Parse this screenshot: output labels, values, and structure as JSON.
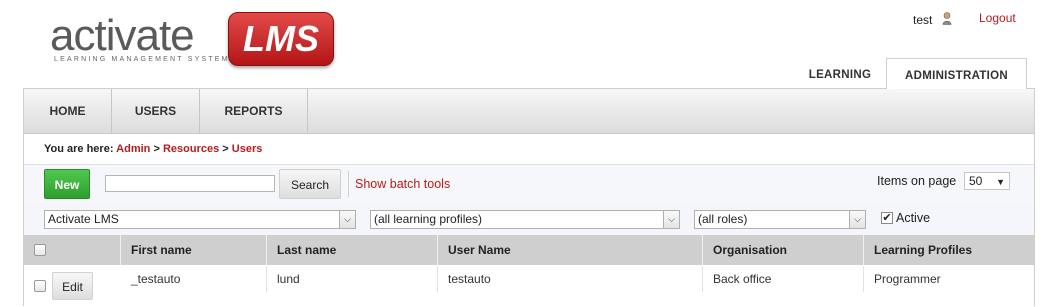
{
  "logo": {
    "word": "activate",
    "badge": "LMS",
    "tagline": "LEARNING MANAGEMENT SYSTEM"
  },
  "header": {
    "username": "test",
    "logout_label": "Logout"
  },
  "top_tabs": [
    {
      "label": "LEARNING"
    },
    {
      "label": "ADMINISTRATION"
    }
  ],
  "nav": {
    "home": "HOME",
    "users": "USERS",
    "reports": "REPORTS"
  },
  "breadcrumb": {
    "prefix": "You are here:",
    "items": [
      "Admin",
      "Resources",
      "Users"
    ],
    "separator": ">"
  },
  "toolbar": {
    "new_label": "New",
    "search_value": "",
    "search_label": "Search",
    "batch_label": "Show batch tools",
    "items_label": "Items on page",
    "items_value": "50"
  },
  "filters": {
    "organisation": "Activate LMS",
    "profiles": "(all learning profiles)",
    "roles": "(all roles)",
    "active_label": "Active",
    "active_checked": true
  },
  "table": {
    "columns": [
      "First name",
      "Last name",
      "User Name",
      "Organisation",
      "Learning Profiles"
    ],
    "rows": [
      {
        "edit_label": "Edit",
        "first_name": "_testauto",
        "last_name": "lund",
        "user_name": "testauto",
        "organisation": "Back office",
        "profiles": "Programmer"
      }
    ]
  },
  "colors": {
    "accent_red": "#b71c1c",
    "new_green": "#3cb43c",
    "header_grey": "#cfcfcf"
  }
}
